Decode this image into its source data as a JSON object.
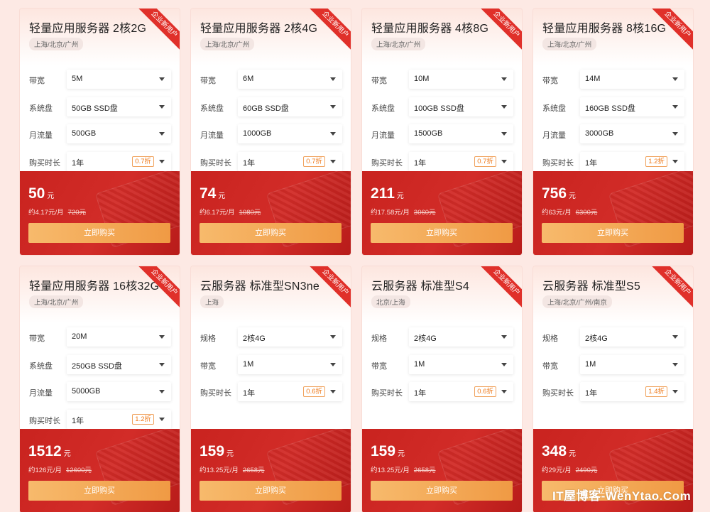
{
  "products": [
    {
      "title": "轻量应用服务器 2核2G",
      "ribbon": "企业新用户",
      "region": "上海/北京/广州",
      "options": [
        {
          "label": "带宽",
          "value": "5M"
        },
        {
          "label": "系统盘",
          "value": "50GB SSD盘"
        },
        {
          "label": "月流量",
          "value": "500GB"
        },
        {
          "label": "购买时长",
          "value": "1年",
          "discount": "0.7折"
        }
      ],
      "price": "50",
      "unit": "元",
      "monthly": "约4.17元/月",
      "original": "720元",
      "button": "立即购买"
    },
    {
      "title": "轻量应用服务器 2核4G",
      "ribbon": "企业新用户",
      "region": "上海/北京/广州",
      "options": [
        {
          "label": "带宽",
          "value": "6M"
        },
        {
          "label": "系统盘",
          "value": "60GB SSD盘"
        },
        {
          "label": "月流量",
          "value": "1000GB"
        },
        {
          "label": "购买时长",
          "value": "1年",
          "discount": "0.7折"
        }
      ],
      "price": "74",
      "unit": "元",
      "monthly": "约6.17元/月",
      "original": "1080元",
      "button": "立即购买"
    },
    {
      "title": "轻量应用服务器 4核8G",
      "ribbon": "企业新用户",
      "region": "上海/北京/广州",
      "options": [
        {
          "label": "带宽",
          "value": "10M"
        },
        {
          "label": "系统盘",
          "value": "100GB SSD盘"
        },
        {
          "label": "月流量",
          "value": "1500GB"
        },
        {
          "label": "购买时长",
          "value": "1年",
          "discount": "0.7折"
        }
      ],
      "price": "211",
      "unit": "元",
      "monthly": "约17.58元/月",
      "original": "3060元",
      "button": "立即购买"
    },
    {
      "title": "轻量应用服务器 8核16G",
      "ribbon": "企业新用户",
      "region": "上海/北京/广州",
      "options": [
        {
          "label": "带宽",
          "value": "14M"
        },
        {
          "label": "系统盘",
          "value": "160GB SSD盘"
        },
        {
          "label": "月流量",
          "value": "3000GB"
        },
        {
          "label": "购买时长",
          "value": "1年",
          "discount": "1.2折"
        }
      ],
      "price": "756",
      "unit": "元",
      "monthly": "约63元/月",
      "original": "6300元",
      "button": "立即购买"
    },
    {
      "title": "轻量应用服务器 16核32G",
      "ribbon": "企业新用户",
      "region": "上海/北京/广州",
      "options": [
        {
          "label": "带宽",
          "value": "20M"
        },
        {
          "label": "系统盘",
          "value": "250GB SSD盘"
        },
        {
          "label": "月流量",
          "value": "5000GB"
        },
        {
          "label": "购买时长",
          "value": "1年",
          "discount": "1.2折"
        }
      ],
      "price": "1512",
      "unit": "元",
      "monthly": "约126元/月",
      "original": "12600元",
      "button": "立即购买"
    },
    {
      "title": "云服务器 标准型SN3ne",
      "ribbon": "企业新用户",
      "region": "上海",
      "options": [
        {
          "label": "规格",
          "value": "2核4G"
        },
        {
          "label": "带宽",
          "value": "1M"
        },
        {
          "label": "购买时长",
          "value": "1年",
          "discount": "0.6折"
        }
      ],
      "price": "159",
      "unit": "元",
      "monthly": "约13.25元/月",
      "original": "2658元",
      "button": "立即购买"
    },
    {
      "title": "云服务器 标准型S4",
      "ribbon": "企业新用户",
      "region": "北京/上海",
      "options": [
        {
          "label": "规格",
          "value": "2核4G"
        },
        {
          "label": "带宽",
          "value": "1M"
        },
        {
          "label": "购买时长",
          "value": "1年",
          "discount": "0.6折"
        }
      ],
      "price": "159",
      "unit": "元",
      "monthly": "约13.25元/月",
      "original": "2658元",
      "button": "立即购买"
    },
    {
      "title": "云服务器 标准型S5",
      "ribbon": "企业新用户",
      "region": "上海/北京/广州/南京",
      "options": [
        {
          "label": "规格",
          "value": "2核4G"
        },
        {
          "label": "带宽",
          "value": "1M"
        },
        {
          "label": "购买时长",
          "value": "1年",
          "discount": "1.4折"
        }
      ],
      "price": "348",
      "unit": "元",
      "monthly": "约29元/月",
      "original": "2490元",
      "button": "立即购买"
    }
  ],
  "watermark": "IT屋博客-WenYtao.Com",
  "colors": {
    "page_bg": "#fde9e4",
    "price_panel": "#c9231f",
    "ribbon": "#e0302a",
    "button": "#f09a44",
    "discount": "#ee7a1a"
  }
}
